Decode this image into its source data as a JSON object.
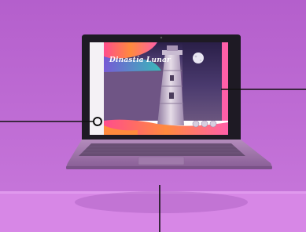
{
  "slide": {
    "title": "Dinastía Lunar"
  },
  "colors": {
    "background": "#c86fd8",
    "floor": "#d684e6",
    "laptop_body": "#9b6aa6",
    "screen_purple": "#7a5c8c",
    "accent_pink": "#ff4d8d",
    "accent_orange": "#ff8a3d",
    "accent_teal": "#35c6c0"
  },
  "icons": [
    "moon-icon",
    "lighthouse-image",
    "callout-marker-icon"
  ]
}
